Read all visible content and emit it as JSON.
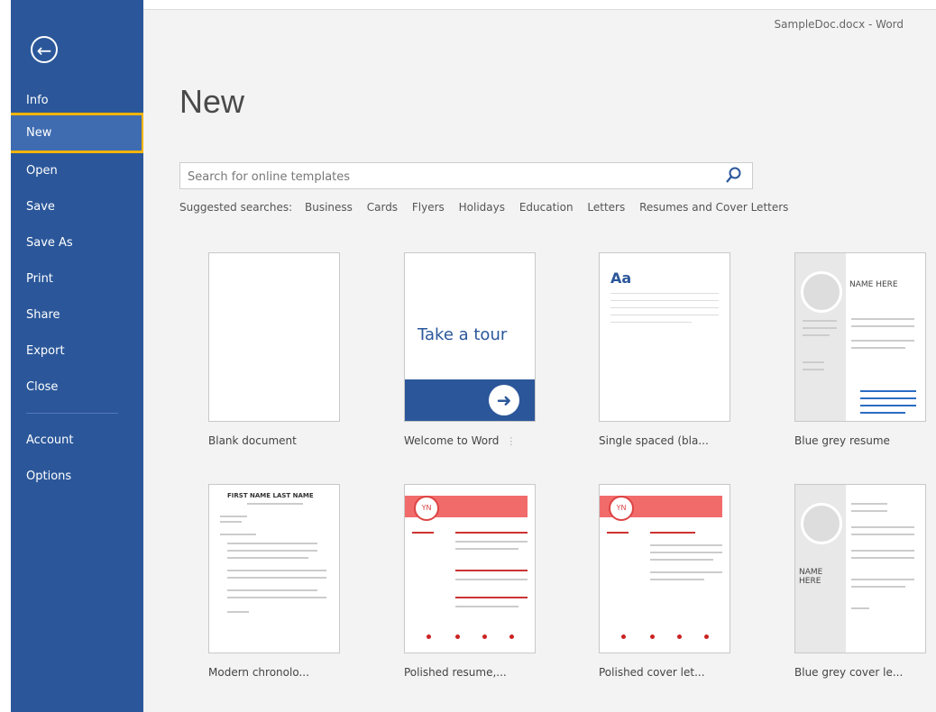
{
  "window_title": "SampleDoc.docx - Word",
  "sidebar": {
    "items": [
      {
        "label": "Info"
      },
      {
        "label": "New"
      },
      {
        "label": "Open"
      },
      {
        "label": "Save"
      },
      {
        "label": "Save As"
      },
      {
        "label": "Print"
      },
      {
        "label": "Share"
      },
      {
        "label": "Export"
      },
      {
        "label": "Close"
      },
      {
        "label": "Account"
      },
      {
        "label": "Options"
      }
    ],
    "active": "New"
  },
  "main": {
    "title": "New",
    "search": {
      "placeholder": "Search for online templates"
    },
    "suggested": {
      "label": "Suggested searches:",
      "links": [
        "Business",
        "Cards",
        "Flyers",
        "Holidays",
        "Education",
        "Letters",
        "Resumes and Cover Letters"
      ]
    },
    "templates": [
      {
        "label": "Blank document"
      },
      {
        "label": "Welcome to Word",
        "tour_text": "Take a tour"
      },
      {
        "label": "Single spaced (bla...",
        "preview_text": "Aa"
      },
      {
        "label": "Blue grey resume",
        "preview_name": "NAME HERE"
      },
      {
        "label": "Modern chronolo...",
        "preview_name": "FIRST NAME LAST NAME"
      },
      {
        "label": "Polished resume,...",
        "preview_initials": "YN"
      },
      {
        "label": "Polished cover let...",
        "preview_initials": "YN"
      },
      {
        "label": "Blue grey cover le...",
        "preview_name": "NAME HERE"
      }
    ]
  },
  "colors": {
    "sidebar": "#2b579a",
    "accent": "#2b579a",
    "highlight": "#f4b400",
    "red_accent": "#e05a5a"
  }
}
